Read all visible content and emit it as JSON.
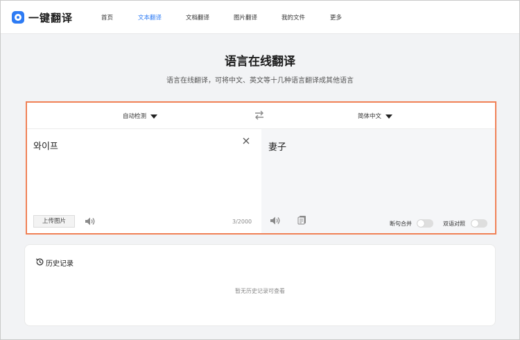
{
  "brand": {
    "name": "一键翻译"
  },
  "nav": {
    "items": [
      {
        "label": "首页",
        "active": false
      },
      {
        "label": "文本翻译",
        "active": true
      },
      {
        "label": "文档翻译",
        "active": false
      },
      {
        "label": "图片翻译",
        "active": false
      },
      {
        "label": "我的文件",
        "active": false
      },
      {
        "label": "更多",
        "active": false
      }
    ]
  },
  "hero": {
    "title": "语言在线翻译",
    "subtitle": "语言在线翻译，可将中文、英文等十几种语言翻译成其他语言"
  },
  "translator": {
    "source_lang": "自动检测",
    "target_lang": "简体中文",
    "source_text": "와이프",
    "target_text": "妻子",
    "upload_label": "上传图片",
    "char_count": "3/2000",
    "merge_label": "断句合并",
    "merge_on": false,
    "bilingual_label": "双语对照",
    "bilingual_on": false
  },
  "history": {
    "title": "历史记录",
    "empty_text": "暂无历史记录可查看"
  },
  "colors": {
    "accent": "#2d7bf4",
    "highlight_border": "#f08055"
  }
}
